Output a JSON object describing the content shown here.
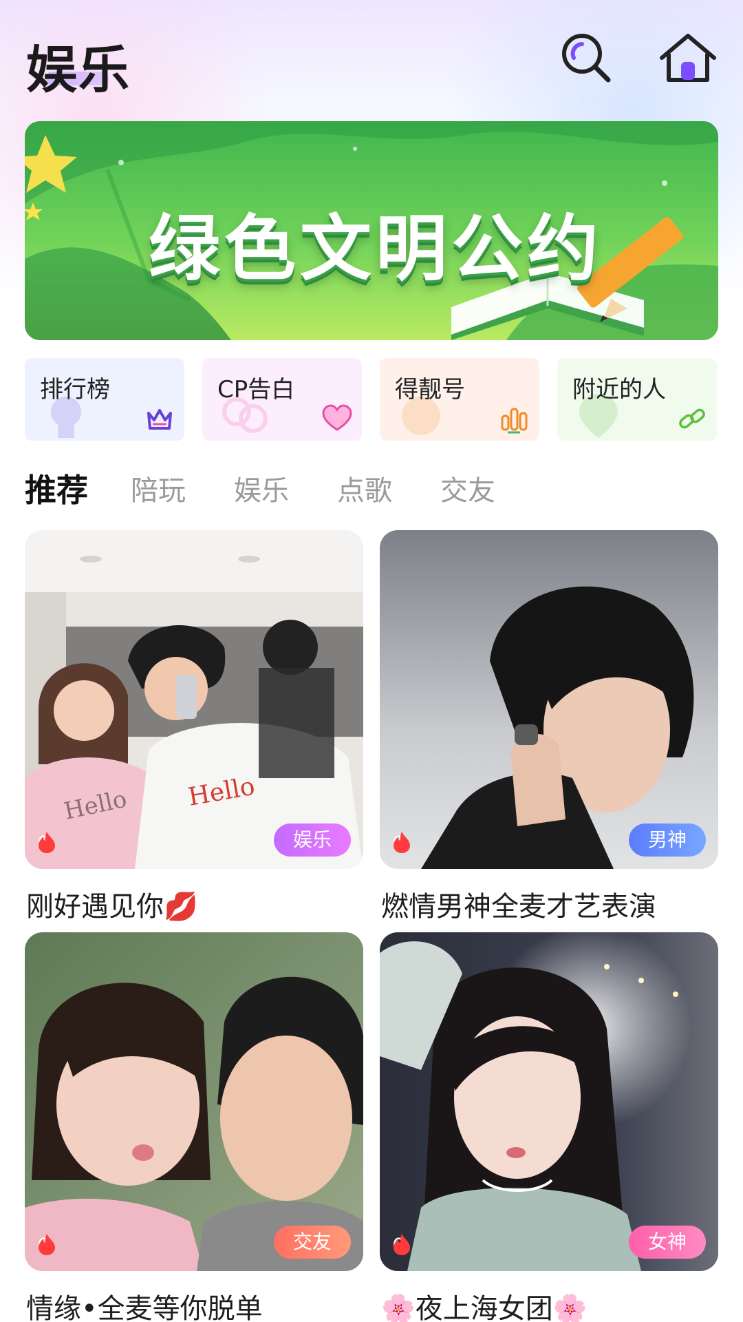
{
  "header": {
    "title": "娱乐",
    "search_icon": "search-icon",
    "home_icon": "home-icon"
  },
  "banner": {
    "text": "绿色文明公约",
    "colors": {
      "top": "#40b64e",
      "bottom": "#b9ea62"
    }
  },
  "shortcuts": [
    {
      "label": "排行榜",
      "icon": "crown-icon",
      "color": "#6a3fd8"
    },
    {
      "label": "CP告白",
      "icon": "heart-icon",
      "color": "#e64fa8"
    },
    {
      "label": "得靓号",
      "icon": "bar-chart-icon",
      "color": "#f08a24"
    },
    {
      "label": "附近的人",
      "icon": "link-icon",
      "color": "#5fbf3a"
    }
  ],
  "tabs": [
    {
      "label": "推荐",
      "active": true
    },
    {
      "label": "陪玩",
      "active": false
    },
    {
      "label": "娱乐",
      "active": false
    },
    {
      "label": "点歌",
      "active": false
    },
    {
      "label": "交友",
      "active": false
    }
  ],
  "rooms": [
    {
      "title": "刚好遇见你💋",
      "heat": "0",
      "tag": "娱乐",
      "tag_colors": [
        "#c46bff",
        "#e97bff"
      ]
    },
    {
      "title": "燃情男神全麦才艺表演",
      "heat": "0",
      "tag": "男神",
      "tag_colors": [
        "#5b7cff",
        "#7aa6ff"
      ]
    },
    {
      "title": "情缘•全麦等你脱单",
      "heat": "0",
      "tag": "交友",
      "tag_colors": [
        "#ff6f61",
        "#ff9a7a"
      ]
    },
    {
      "title": "🌸夜上海女团🌸",
      "heat": "0",
      "tag": "女神",
      "tag_colors": [
        "#ff5fa8",
        "#ff8ac4"
      ]
    }
  ]
}
